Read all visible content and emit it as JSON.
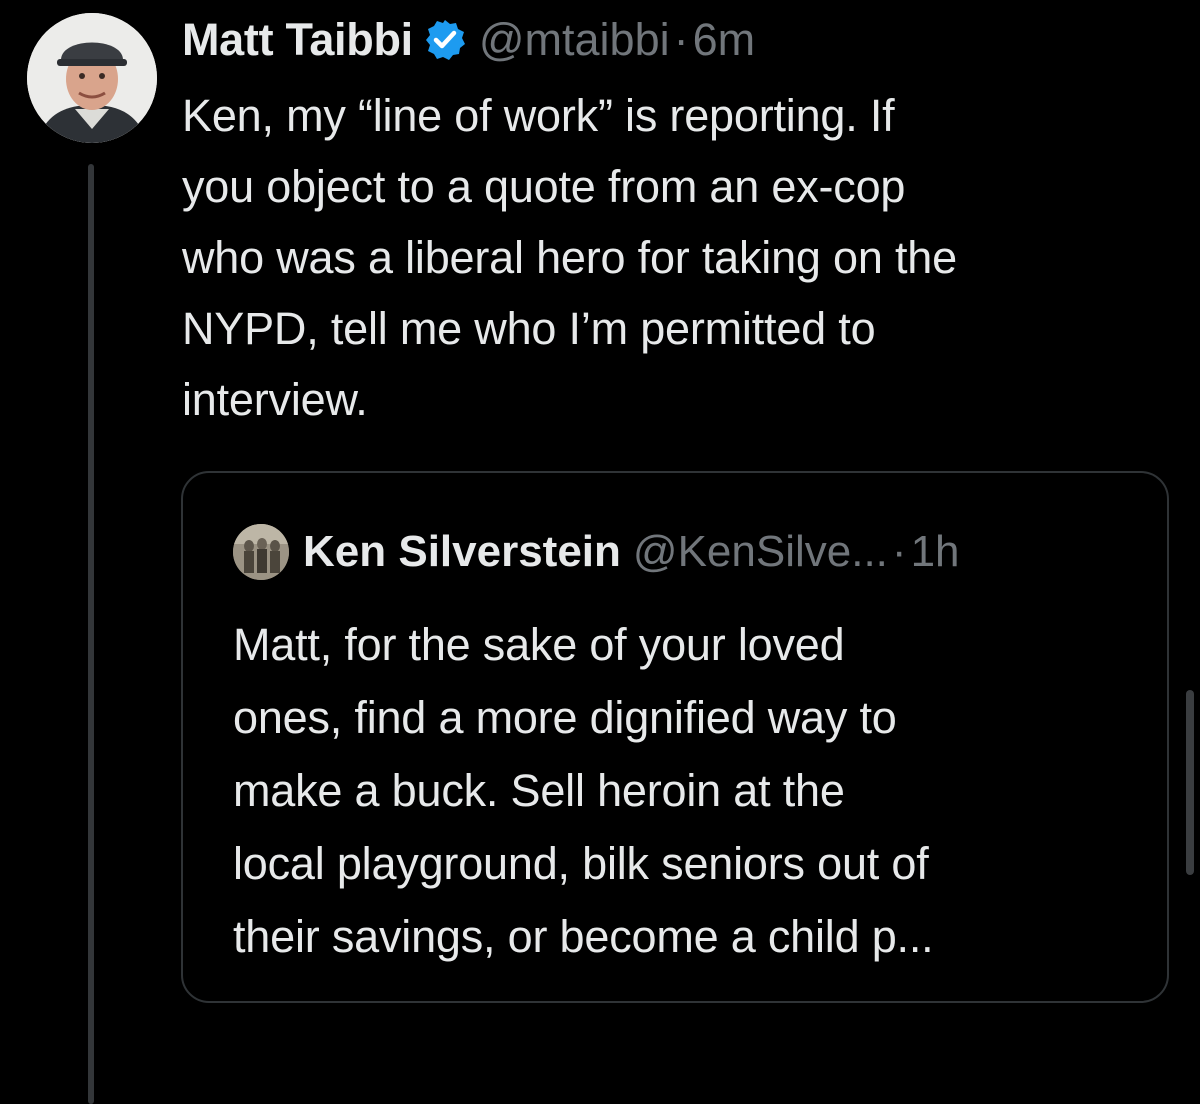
{
  "tweet": {
    "author": {
      "display_name": "Matt Taibbi",
      "handle": "@mtaibbi",
      "verified": true,
      "avatar_icon": "profile-photo"
    },
    "separator": "·",
    "time": "6m",
    "text": "Ken, my “line of work” is reporting. If\nyou object to a quote from an ex-cop\nwho was a liberal hero for taking on the\nNYPD, tell me who I’m permitted to\ninterview."
  },
  "quote": {
    "author": {
      "display_name": "Ken Silverstein",
      "handle": "@KenSilve...",
      "avatar_icon": "profile-photo"
    },
    "separator": "·",
    "time": "1h",
    "text": "Matt, for the sake of your loved\nones, find a more dignified way to\nmake a buck. Sell heroin at the\nlocal playground, bilk seniors out of\ntheir savings, or become a child p..."
  },
  "colors": {
    "background": "#000000",
    "primary_text": "#e7e9ea",
    "secondary_text": "#71767b",
    "verified_badge": "#1d9bf0",
    "border": "#2f3336"
  }
}
